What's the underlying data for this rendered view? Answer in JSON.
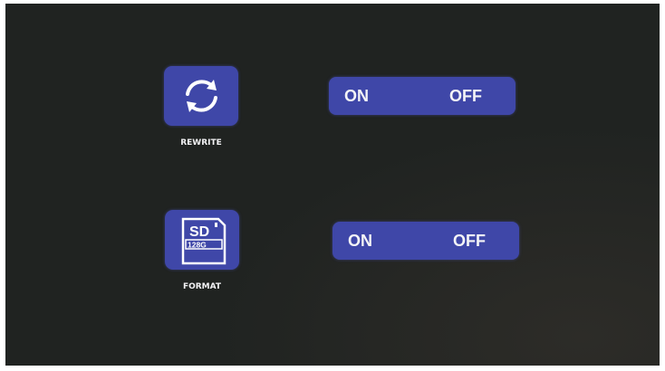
{
  "settings": [
    {
      "label": "REWRITE",
      "icon": "refresh-icon",
      "toggle": {
        "on_label": "ON",
        "off_label": "OFF"
      }
    },
    {
      "label": "FORMAT",
      "icon": "sd-card-icon",
      "sd_card": {
        "title": "SD",
        "capacity": "128G"
      },
      "toggle": {
        "on_label": "ON",
        "off_label": "OFF"
      }
    }
  ],
  "colors": {
    "background": "#202321",
    "accent": "#3f47a8",
    "text": "#f2f2f4"
  }
}
